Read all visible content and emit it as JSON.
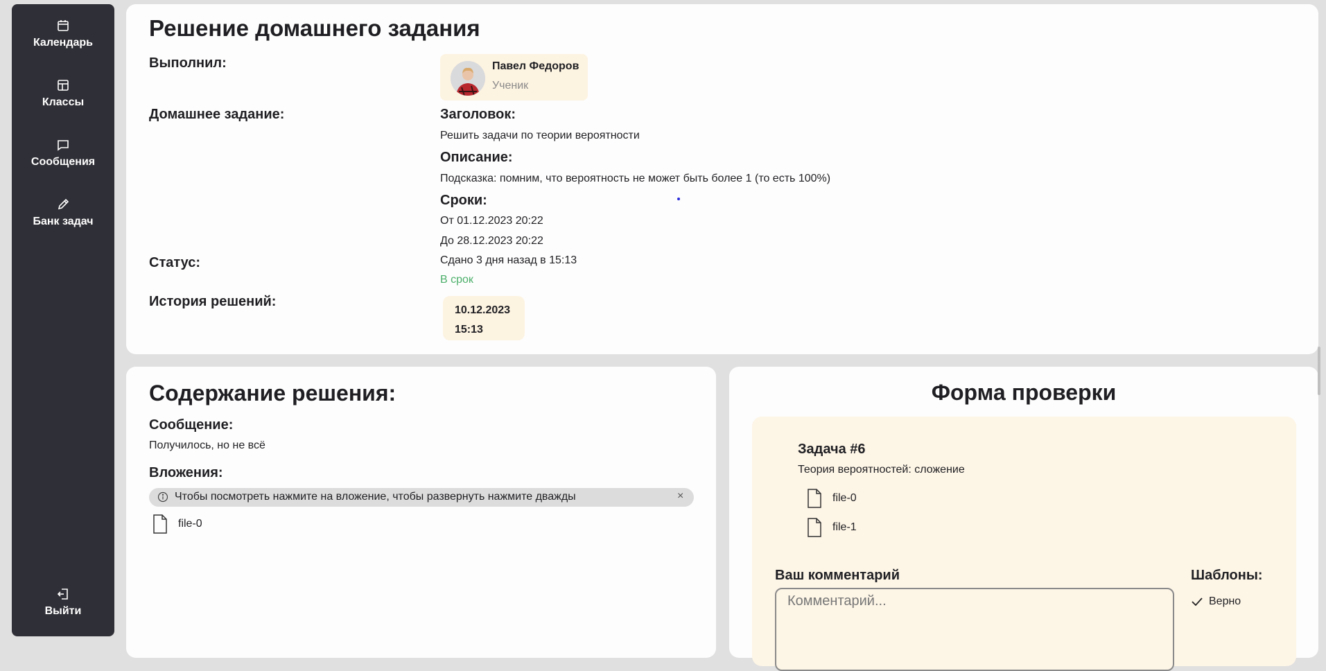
{
  "sidebar": {
    "items": [
      {
        "label": "Календарь",
        "icon": "calendar-icon"
      },
      {
        "label": "Классы",
        "icon": "layout-icon"
      },
      {
        "label": "Сообщения",
        "icon": "message-icon"
      },
      {
        "label": "Банк задач",
        "icon": "pencil-icon"
      }
    ],
    "logout": {
      "label": "Выйти",
      "icon": "logout-icon"
    }
  },
  "homework": {
    "title": "Решение домашнего задания",
    "labels": {
      "author": "Выполнил:",
      "task": "Домашнее задание:",
      "status": "Статус:",
      "history": "История решений:"
    },
    "author": {
      "name": "Павел Федоров",
      "role": "Ученик"
    },
    "task": {
      "heading_label": "Заголовок:",
      "heading": "Решить задачи по теории вероятности",
      "description_label": "Описание:",
      "description": "Подсказка: помним, что вероятность не может быть более 1 (то есть 100%)",
      "deadlines_label": "Сроки:",
      "from": "От 01.12.2023 20:22",
      "to": "До 28.12.2023 20:22"
    },
    "status": {
      "submitted": "Сдано 3 дня назад в 15:13",
      "timeliness": "В срок"
    },
    "history": [
      {
        "date": "10.12.2023",
        "time": "15:13"
      }
    ]
  },
  "solution": {
    "title": "Содержание решения:",
    "message_label": "Сообщение:",
    "message": "Получилось, но не всё",
    "attachments_label": "Вложения:",
    "hint": "Чтобы посмотреть нажмите на вложение, чтобы развернуть нажмите дважды",
    "hint_close": "×",
    "files": [
      "file-0"
    ]
  },
  "check_form": {
    "title": "Форма проверки",
    "task_title": "Задача #6",
    "task_desc": "Теория вероятностей: сложение",
    "files": [
      "file-0",
      "file-1"
    ],
    "comment_label": "Ваш комментарий",
    "comment_placeholder": "Комментарий...",
    "templates_label": "Шаблоны:",
    "templates": [
      "Верно"
    ]
  }
}
